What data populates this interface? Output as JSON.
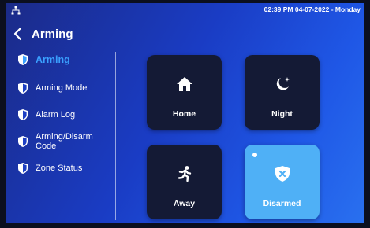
{
  "status_bar": {
    "network_icon": "network-icon",
    "datetime": "02:39 PM  04-07-2022 - Monday"
  },
  "header": {
    "back_icon": "chevron-left-icon",
    "title": "Arming"
  },
  "sidebar": {
    "items": [
      {
        "label": "Arming",
        "icon": "shield-icon",
        "active": true
      },
      {
        "label": "Arming Mode",
        "icon": "shield-icon",
        "active": false
      },
      {
        "label": "Alarm Log",
        "icon": "shield-icon",
        "active": false
      },
      {
        "label": "Arming/Disarm Code",
        "icon": "shield-icon",
        "active": false
      },
      {
        "label": "Zone Status",
        "icon": "shield-icon",
        "active": false
      }
    ]
  },
  "modes": {
    "home": {
      "label": "Home",
      "icon": "house-icon"
    },
    "night": {
      "label": "Night",
      "icon": "moon-icon"
    },
    "away": {
      "label": "Away",
      "icon": "running-person-icon"
    },
    "disarmed": {
      "label": "Disarmed",
      "icon": "shield-x-icon",
      "selected": true
    }
  },
  "colors": {
    "accent": "#3aa0ff",
    "tile_dark": "#141a35",
    "tile_selected": "#4fb0f6"
  }
}
